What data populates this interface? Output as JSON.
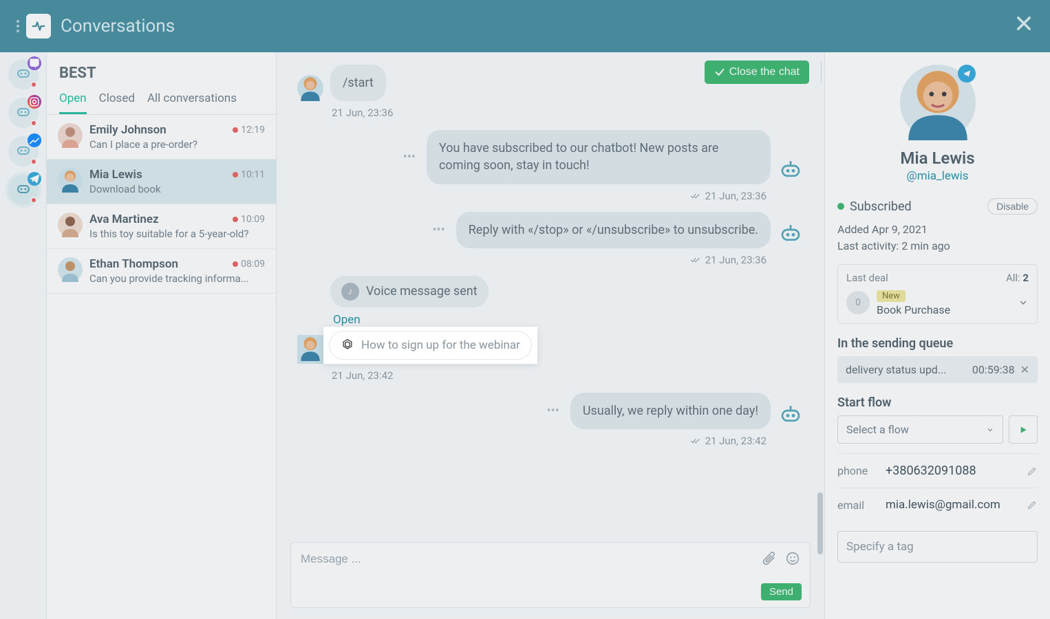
{
  "topbar": {
    "title": "Conversations"
  },
  "convlist": {
    "title": "BEST",
    "tabs": {
      "open": "Open",
      "closed": "Closed",
      "all": "All conversations"
    },
    "items": [
      {
        "name": "Emily Johnson",
        "preview": "Can I place a pre-order?",
        "time": "12:19"
      },
      {
        "name": "Mia Lewis",
        "preview": "Download book",
        "time": "10:11"
      },
      {
        "name": "Ava Martinez",
        "preview": "Is this toy suitable for a 5-year-old?",
        "time": "10:09"
      },
      {
        "name": "Ethan Thompson",
        "preview": "Can you provide tracking informa...",
        "time": "08:09"
      }
    ]
  },
  "chat": {
    "close_label": "Close the chat",
    "start_cmd": "/start",
    "ts1": "21 Jun, 23:36",
    "bot_sub": "You have subscribed to our chatbot! New posts are coming soon, stay in touch!",
    "ts2": "21 Jun, 23:36",
    "bot_unsub": "Reply with «/stop» or «/unsubscribe» to unsubscribe.",
    "ts3": "21 Jun, 23:36",
    "voice_label": "Voice message sent",
    "open_label": "Open",
    "gpt_text": "How to sign up for the webinar",
    "ts4": "21 Jun, 23:42",
    "reply_day": "Usually, we reply within one day!",
    "ts5": "21 Jun, 23:42",
    "composer_placeholder": "Message ...",
    "send_label": "Send"
  },
  "side": {
    "name": "Mia Lewis",
    "username": "@mia_lewis",
    "subscribed": "Subscribed",
    "disable": "Disable",
    "added": "Added Apr 9, 2021",
    "activity": "Last activity: 2 min ago",
    "deal": {
      "last": "Last deal",
      "all_label": "All:",
      "all_count": "2",
      "new": "New",
      "title": "Book Purchase"
    },
    "queue_title": "In the sending queue",
    "queue_item": "delivery status upd...",
    "queue_timer": "00:59:38",
    "start_flow": "Start flow",
    "select_flow": "Select a flow",
    "phone_k": "phone",
    "phone_v": "+380632091088",
    "email_k": "email",
    "email_v": "mia.lewis@gmail.com",
    "tag_placeholder": "Specify a tag"
  }
}
